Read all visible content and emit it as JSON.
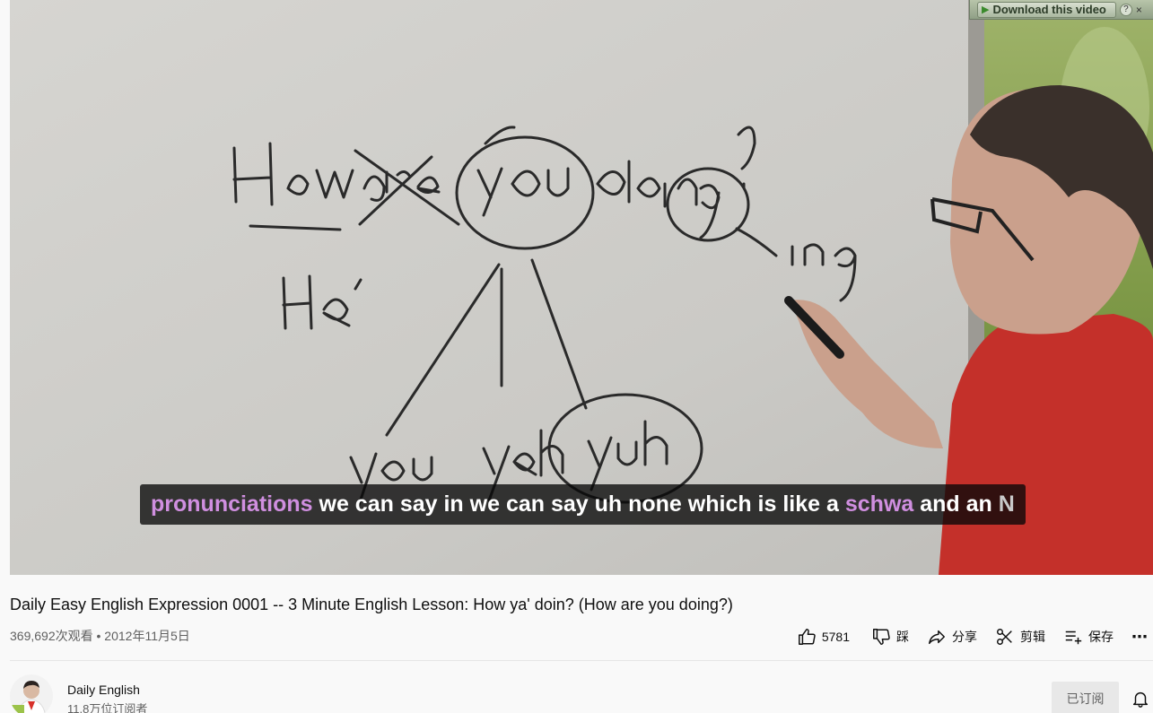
{
  "download_bar": {
    "label": "Download this video",
    "help": "?",
    "close": "×"
  },
  "caption": {
    "segments": [
      {
        "text": "pronunciations",
        "style": "kw"
      },
      {
        "text": " we can say in we can say uh none which is like a ",
        "style": "normal"
      },
      {
        "text": "schwa",
        "style": "kw"
      },
      {
        "text": " and an ",
        "style": "normal"
      },
      {
        "text": "N",
        "style": "fade"
      }
    ]
  },
  "video": {
    "title": "Daily Easy English Expression 0001 -- 3 Minute English Lesson: How ya' doin? (How are you doing?)",
    "views": "369,692次观看",
    "separator": "•",
    "date": "2012年11月5日"
  },
  "actions": {
    "like_count": "5781",
    "dislike_label": "踩",
    "share_label": "分享",
    "clip_label": "剪辑",
    "save_label": "保存",
    "more_label": "⋯"
  },
  "channel": {
    "name": "Daily English",
    "subscribers": "11.8万位订阅者",
    "subscribe_button": "已订阅"
  },
  "colors": {
    "caption_keyword": "#d08fe0",
    "page_background": "#f9f9f9",
    "subscribed_button": "#e8e8e8"
  },
  "icons": [
    "play-icon",
    "help-icon",
    "close-icon",
    "thumbs-up-icon",
    "thumbs-down-icon",
    "share-icon",
    "scissors-icon",
    "playlist-add-icon",
    "more-icon",
    "bell-icon"
  ]
}
